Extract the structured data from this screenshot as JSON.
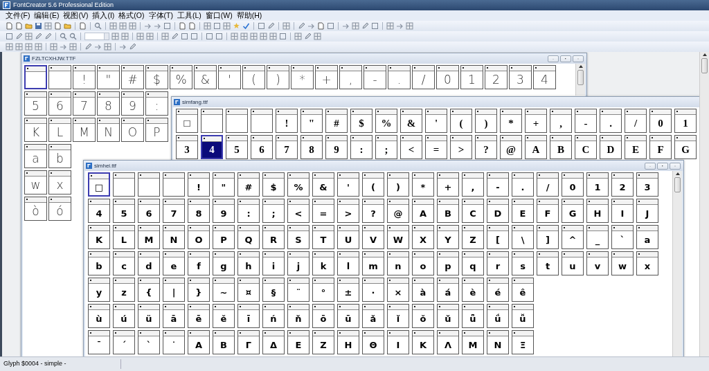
{
  "app": {
    "title": "FontCreator 5.6 Professional Edition"
  },
  "menu": [
    "文件(F)",
    "编辑(E)",
    "视图(V)",
    "插入(I)",
    "格式(O)",
    "字体(T)",
    "工具(L)",
    "窗口(W)",
    "帮助(H)"
  ],
  "windows": [
    {
      "title": "FZLTCXHJW.TTF",
      "filled_selection": false,
      "rows": [
        [
          {
            "selected": true
          },
          {
            "selected": false
          },
          {
            "glyph": "!",
            "selected": false
          },
          {
            "glyph": "\"",
            "selected": false
          },
          {
            "glyph": "#",
            "selected": false
          },
          {
            "glyph": "$",
            "selected": false
          },
          {
            "glyph": "%",
            "selected": false
          },
          {
            "glyph": "&",
            "selected": false
          },
          {
            "glyph": "'",
            "selected": false
          },
          {
            "glyph": "(",
            "selected": false
          },
          {
            "glyph": ")",
            "selected": false
          },
          {
            "glyph": "*",
            "selected": false
          },
          {
            "glyph": "+",
            "selected": false
          },
          {
            "glyph": ",",
            "selected": false
          },
          {
            "glyph": "-",
            "selected": false
          },
          {
            "glyph": ".",
            "selected": false
          },
          {
            "glyph": "/",
            "selected": false
          },
          {
            "glyph": "0",
            "selected": false
          },
          {
            "glyph": "1",
            "selected": false
          },
          {
            "glyph": "2",
            "selected": false
          },
          {
            "glyph": "3",
            "selected": false
          },
          {
            "glyph": "4",
            "selected": false
          }
        ],
        [
          {
            "glyph": "5",
            "selected": false
          },
          {
            "glyph": "6",
            "selected": false
          },
          {
            "glyph": "7",
            "selected": false
          },
          {
            "glyph": "8",
            "selected": false
          },
          {
            "glyph": "9",
            "selected": false
          },
          {
            "glyph": ":",
            "selected": false
          }
        ],
        [
          {
            "glyph": "K",
            "selected": false
          },
          {
            "glyph": "L",
            "selected": false
          },
          {
            "glyph": "M",
            "selected": false
          },
          {
            "glyph": "N",
            "selected": false
          },
          {
            "glyph": "O",
            "selected": false
          },
          {
            "glyph": "P",
            "selected": false
          }
        ],
        [
          {
            "glyph": "a",
            "selected": false
          },
          {
            "glyph": "b",
            "selected": false
          }
        ],
        [
          {
            "glyph": "w",
            "selected": false
          },
          {
            "glyph": "x",
            "selected": false
          }
        ],
        [
          {
            "glyph": "ò",
            "selected": false
          },
          {
            "glyph": "ó",
            "selected": false
          }
        ]
      ]
    },
    {
      "title": "simfang.ttf",
      "filled_selection": true,
      "rows": [
        [
          {
            "glyph": "□",
            "selected": false
          },
          {
            "selected": false
          },
          {
            "selected": false
          },
          {
            "selected": false
          },
          {
            "glyph": "!",
            "selected": false
          },
          {
            "glyph": "\"",
            "selected": false
          },
          {
            "glyph": "#",
            "selected": false
          },
          {
            "glyph": "$",
            "selected": false
          },
          {
            "glyph": "%",
            "selected": false
          },
          {
            "glyph": "&",
            "selected": false
          },
          {
            "glyph": "'",
            "selected": false
          },
          {
            "glyph": "(",
            "selected": false
          },
          {
            "glyph": ")",
            "selected": false
          },
          {
            "glyph": "*",
            "selected": false
          },
          {
            "glyph": "+",
            "selected": false
          },
          {
            "glyph": ",",
            "selected": false
          },
          {
            "glyph": "-",
            "selected": false
          },
          {
            "glyph": ".",
            "selected": false
          },
          {
            "glyph": "/",
            "selected": false
          },
          {
            "glyph": "0",
            "selected": false
          },
          {
            "glyph": "1",
            "selected": false
          }
        ],
        [
          {
            "glyph": "3",
            "selected": false
          },
          {
            "glyph": "4",
            "selected": true
          },
          {
            "glyph": "5",
            "selected": false
          },
          {
            "glyph": "6",
            "selected": false
          },
          {
            "glyph": "7",
            "selected": false
          },
          {
            "glyph": "8",
            "selected": false
          },
          {
            "glyph": "9",
            "selected": false
          },
          {
            "glyph": ":",
            "selected": false
          },
          {
            "glyph": ";",
            "selected": false
          },
          {
            "glyph": "<",
            "selected": false
          },
          {
            "glyph": "=",
            "selected": false
          },
          {
            "glyph": ">",
            "selected": false
          },
          {
            "glyph": "?",
            "selected": false
          },
          {
            "glyph": "@",
            "selected": false
          },
          {
            "glyph": "A",
            "selected": false
          },
          {
            "glyph": "B",
            "selected": false
          },
          {
            "glyph": "C",
            "selected": false
          },
          {
            "glyph": "D",
            "selected": false
          },
          {
            "glyph": "E",
            "selected": false
          },
          {
            "glyph": "F",
            "selected": false
          },
          {
            "glyph": "G",
            "selected": false
          }
        ]
      ]
    },
    {
      "title": "simhei.ttf",
      "filled_selection": false,
      "rows": [
        [
          {
            "glyph": "□",
            "selected": true
          },
          {
            "selected": false
          },
          {
            "selected": false
          },
          {
            "selected": false
          },
          {
            "glyph": "!",
            "selected": false
          },
          {
            "glyph": "\"",
            "selected": false
          },
          {
            "glyph": "#",
            "selected": false
          },
          {
            "glyph": "$",
            "selected": false
          },
          {
            "glyph": "%",
            "selected": false
          },
          {
            "glyph": "&",
            "selected": false
          },
          {
            "glyph": "'",
            "selected": false
          },
          {
            "glyph": "(",
            "selected": false
          },
          {
            "glyph": ")",
            "selected": false
          },
          {
            "glyph": "*",
            "selected": false
          },
          {
            "glyph": "+",
            "selected": false
          },
          {
            "glyph": ",",
            "selected": false
          },
          {
            "glyph": "-",
            "selected": false
          },
          {
            "glyph": ".",
            "selected": false
          },
          {
            "glyph": "/",
            "selected": false
          },
          {
            "glyph": "0",
            "selected": false
          },
          {
            "glyph": "1",
            "selected": false
          },
          {
            "glyph": "2",
            "selected": false
          },
          {
            "glyph": "3",
            "selected": false
          }
        ],
        [
          {
            "glyph": "4",
            "selected": false
          },
          {
            "glyph": "5",
            "selected": false
          },
          {
            "glyph": "6",
            "selected": false
          },
          {
            "glyph": "7",
            "selected": false
          },
          {
            "glyph": "8",
            "selected": false
          },
          {
            "glyph": "9",
            "selected": false
          },
          {
            "glyph": ":",
            "selected": false
          },
          {
            "glyph": ";",
            "selected": false
          },
          {
            "glyph": "<",
            "selected": false
          },
          {
            "glyph": "=",
            "selected": false
          },
          {
            "glyph": ">",
            "selected": false
          },
          {
            "glyph": "?",
            "selected": false
          },
          {
            "glyph": "@",
            "selected": false
          },
          {
            "glyph": "A",
            "selected": false
          },
          {
            "glyph": "B",
            "selected": false
          },
          {
            "glyph": "C",
            "selected": false
          },
          {
            "glyph": "D",
            "selected": false
          },
          {
            "glyph": "E",
            "selected": false
          },
          {
            "glyph": "F",
            "selected": false
          },
          {
            "glyph": "G",
            "selected": false
          },
          {
            "glyph": "H",
            "selected": false
          },
          {
            "glyph": "I",
            "selected": false
          },
          {
            "glyph": "J",
            "selected": false
          }
        ],
        [
          {
            "glyph": "K",
            "selected": false
          },
          {
            "glyph": "L",
            "selected": false
          },
          {
            "glyph": "M",
            "selected": false
          },
          {
            "glyph": "N",
            "selected": false
          },
          {
            "glyph": "O",
            "selected": false
          },
          {
            "glyph": "P",
            "selected": false
          },
          {
            "glyph": "Q",
            "selected": false
          },
          {
            "glyph": "R",
            "selected": false
          },
          {
            "glyph": "S",
            "selected": false
          },
          {
            "glyph": "T",
            "selected": false
          },
          {
            "glyph": "U",
            "selected": false
          },
          {
            "glyph": "V",
            "selected": false
          },
          {
            "glyph": "W",
            "selected": false
          },
          {
            "glyph": "X",
            "selected": false
          },
          {
            "glyph": "Y",
            "selected": false
          },
          {
            "glyph": "Z",
            "selected": false
          },
          {
            "glyph": "[",
            "selected": false
          },
          {
            "glyph": "\\",
            "selected": false
          },
          {
            "glyph": "]",
            "selected": false
          },
          {
            "glyph": "^",
            "selected": false
          },
          {
            "glyph": "_",
            "selected": false
          },
          {
            "glyph": "`",
            "selected": false
          },
          {
            "glyph": "a",
            "selected": false
          }
        ],
        [
          {
            "glyph": "b",
            "selected": false
          },
          {
            "glyph": "c",
            "selected": false
          },
          {
            "glyph": "d",
            "selected": false
          },
          {
            "glyph": "e",
            "selected": false
          },
          {
            "glyph": "f",
            "selected": false
          },
          {
            "glyph": "g",
            "selected": false
          },
          {
            "glyph": "h",
            "selected": false
          },
          {
            "glyph": "i",
            "selected": false
          },
          {
            "glyph": "j",
            "selected": false
          },
          {
            "glyph": "k",
            "selected": false
          },
          {
            "glyph": "l",
            "selected": false
          },
          {
            "glyph": "m",
            "selected": false
          },
          {
            "glyph": "n",
            "selected": false
          },
          {
            "glyph": "o",
            "selected": false
          },
          {
            "glyph": "p",
            "selected": false
          },
          {
            "glyph": "q",
            "selected": false
          },
          {
            "glyph": "r",
            "selected": false
          },
          {
            "glyph": "s",
            "selected": false
          },
          {
            "glyph": "t",
            "selected": false
          },
          {
            "glyph": "u",
            "selected": false
          },
          {
            "glyph": "v",
            "selected": false
          },
          {
            "glyph": "w",
            "selected": false
          },
          {
            "glyph": "x",
            "selected": false
          }
        ],
        [
          {
            "glyph": "y",
            "selected": false
          },
          {
            "glyph": "z",
            "selected": false
          },
          {
            "glyph": "{",
            "selected": false
          },
          {
            "glyph": "|",
            "selected": false
          },
          {
            "glyph": "}",
            "selected": false
          },
          {
            "glyph": "~",
            "selected": false
          },
          {
            "glyph": "¤",
            "selected": false
          },
          {
            "glyph": "§",
            "selected": false
          },
          {
            "glyph": "¨",
            "selected": false
          },
          {
            "glyph": "°",
            "selected": false
          },
          {
            "glyph": "±",
            "selected": false
          },
          {
            "glyph": "·",
            "selected": false
          },
          {
            "glyph": "×",
            "selected": false
          },
          {
            "glyph": "à",
            "selected": false
          },
          {
            "glyph": "á",
            "selected": false
          },
          {
            "glyph": "è",
            "selected": false
          },
          {
            "glyph": "é",
            "selected": false
          },
          {
            "glyph": "ê",
            "selected": false
          }
        ],
        [
          {
            "glyph": "ù",
            "selected": false
          },
          {
            "glyph": "ú",
            "selected": false
          },
          {
            "glyph": "ü",
            "selected": false
          },
          {
            "glyph": "ā",
            "selected": false
          },
          {
            "glyph": "ē",
            "selected": false
          },
          {
            "glyph": "ě",
            "selected": false
          },
          {
            "glyph": "ī",
            "selected": false
          },
          {
            "glyph": "ń",
            "selected": false
          },
          {
            "glyph": "ň",
            "selected": false
          },
          {
            "glyph": "ō",
            "selected": false
          },
          {
            "glyph": "ū",
            "selected": false
          },
          {
            "glyph": "ǎ",
            "selected": false
          },
          {
            "glyph": "ǐ",
            "selected": false
          },
          {
            "glyph": "ǒ",
            "selected": false
          },
          {
            "glyph": "ǔ",
            "selected": false
          },
          {
            "glyph": "ǖ",
            "selected": false
          },
          {
            "glyph": "ǘ",
            "selected": false
          },
          {
            "glyph": "ǚ",
            "selected": false
          }
        ],
        [
          {
            "glyph": "ˉ",
            "selected": false
          },
          {
            "glyph": "ˊ",
            "selected": false
          },
          {
            "glyph": "ˋ",
            "selected": false
          },
          {
            "glyph": "˙",
            "selected": false
          },
          {
            "glyph": "Α",
            "selected": false
          },
          {
            "glyph": "Β",
            "selected": false
          },
          {
            "glyph": "Γ",
            "selected": false
          },
          {
            "glyph": "Δ",
            "selected": false
          },
          {
            "glyph": "Ε",
            "selected": false
          },
          {
            "glyph": "Ζ",
            "selected": false
          },
          {
            "glyph": "Η",
            "selected": false
          },
          {
            "glyph": "Θ",
            "selected": false
          },
          {
            "glyph": "Ι",
            "selected": false
          },
          {
            "glyph": "Κ",
            "selected": false
          },
          {
            "glyph": "Λ",
            "selected": false
          },
          {
            "glyph": "Μ",
            "selected": false
          },
          {
            "glyph": "Ν",
            "selected": false
          },
          {
            "glyph": "Ξ",
            "selected": false
          }
        ]
      ]
    }
  ],
  "status_bar": [
    "Glyph $0004 - simple -"
  ]
}
